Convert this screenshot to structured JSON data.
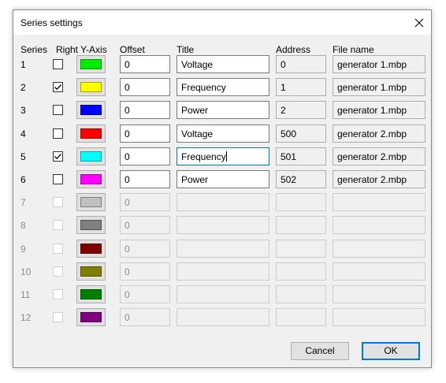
{
  "window": {
    "title": "Series settings"
  },
  "headers": {
    "series": "Series",
    "right_y_axis": "Right Y-Axis",
    "offset": "Offset",
    "title": "Title",
    "address": "Address",
    "file_name": "File name"
  },
  "rows": [
    {
      "num": "1",
      "right_axis": false,
      "color": "#00ee00",
      "offset": "0",
      "title": "Voltage",
      "address": "0",
      "file": "generator 1.mbp",
      "enabled": true
    },
    {
      "num": "2",
      "right_axis": true,
      "color": "#ffff00",
      "offset": "0",
      "title": "Frequency",
      "address": "1",
      "file": "generator 1.mbp",
      "enabled": true
    },
    {
      "num": "3",
      "right_axis": false,
      "color": "#0000ff",
      "offset": "0",
      "title": "Power",
      "address": "2",
      "file": "generator 1.mbp",
      "enabled": true
    },
    {
      "num": "4",
      "right_axis": false,
      "color": "#ff0000",
      "offset": "0",
      "title": "Voltage",
      "address": "500",
      "file": "generator 2.mbp",
      "enabled": true
    },
    {
      "num": "5",
      "right_axis": true,
      "color": "#00ffff",
      "offset": "0",
      "title": "Frequency",
      "address": "501",
      "file": "generator 2.mbp",
      "enabled": true,
      "focused": true
    },
    {
      "num": "6",
      "right_axis": false,
      "color": "#ff00ff",
      "offset": "0",
      "title": "Power",
      "address": "502",
      "file": "generator 2.mbp",
      "enabled": true
    },
    {
      "num": "7",
      "right_axis": false,
      "color": "#c0c0c0",
      "offset": "0",
      "title": "",
      "address": "",
      "file": "",
      "enabled": false
    },
    {
      "num": "8",
      "right_axis": false,
      "color": "#808080",
      "offset": "0",
      "title": "",
      "address": "",
      "file": "",
      "enabled": false
    },
    {
      "num": "9",
      "right_axis": false,
      "color": "#800000",
      "offset": "0",
      "title": "",
      "address": "",
      "file": "",
      "enabled": false
    },
    {
      "num": "10",
      "right_axis": false,
      "color": "#808000",
      "offset": "0",
      "title": "",
      "address": "",
      "file": "",
      "enabled": false
    },
    {
      "num": "11",
      "right_axis": false,
      "color": "#008000",
      "offset": "0",
      "title": "",
      "address": "",
      "file": "",
      "enabled": false
    },
    {
      "num": "12",
      "right_axis": false,
      "color": "#800080",
      "offset": "0",
      "title": "",
      "address": "",
      "file": "",
      "enabled": false
    }
  ],
  "buttons": {
    "cancel": "Cancel",
    "ok": "OK"
  },
  "icons": {
    "close": "close-icon",
    "check": "check-icon"
  }
}
